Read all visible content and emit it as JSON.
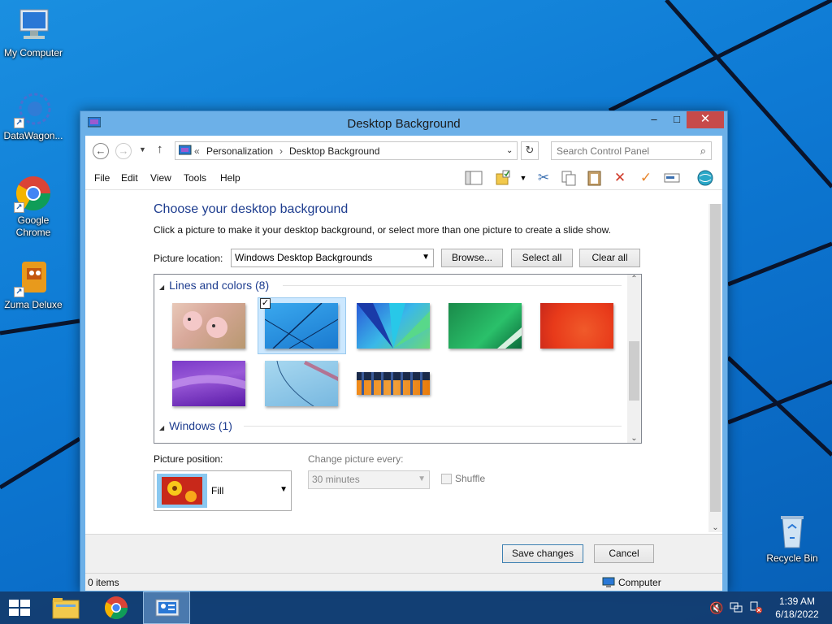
{
  "desktop": {
    "icons": [
      {
        "label": "My Computer"
      },
      {
        "label": "DataWagon..."
      },
      {
        "label": "Google Chrome"
      },
      {
        "label": "Zuma Deluxe"
      },
      {
        "label": "Recycle Bin"
      }
    ]
  },
  "window": {
    "title": "Desktop Background",
    "controls": {
      "minimize": "–",
      "maximize": "□",
      "close": "✕"
    },
    "address": {
      "prefix": "«",
      "crumbs": [
        "Personalization",
        "Desktop Background"
      ],
      "separator": "›"
    },
    "search": {
      "placeholder": "Search Control Panel"
    },
    "menu": [
      "File",
      "Edit",
      "View",
      "Tools",
      "Help"
    ],
    "heading": "Choose your desktop background",
    "subtitle": "Click a picture to make it your desktop background, or select more than one picture to create a slide show.",
    "picture_location": {
      "label": "Picture location:",
      "value": "Windows Desktop Backgrounds",
      "browse": "Browse...",
      "select_all": "Select all",
      "clear_all": "Clear all"
    },
    "groups": [
      {
        "title": "Lines and colors (8)"
      },
      {
        "title": "Windows (1)"
      }
    ],
    "picture_position": {
      "label": "Picture position:",
      "value": "Fill"
    },
    "change_every": {
      "label": "Change picture every:",
      "value": "30 minutes"
    },
    "shuffle": {
      "label": "Shuffle"
    },
    "save": "Save changes",
    "cancel": "Cancel",
    "status": {
      "items": "0 items",
      "location": "Computer"
    }
  },
  "taskbar": {
    "time": "1:39 AM",
    "date": "6/18/2022"
  },
  "colors": {
    "accent": "#1e3d8f",
    "close": "#c74a4a",
    "desktop": "#0e7ad4"
  }
}
